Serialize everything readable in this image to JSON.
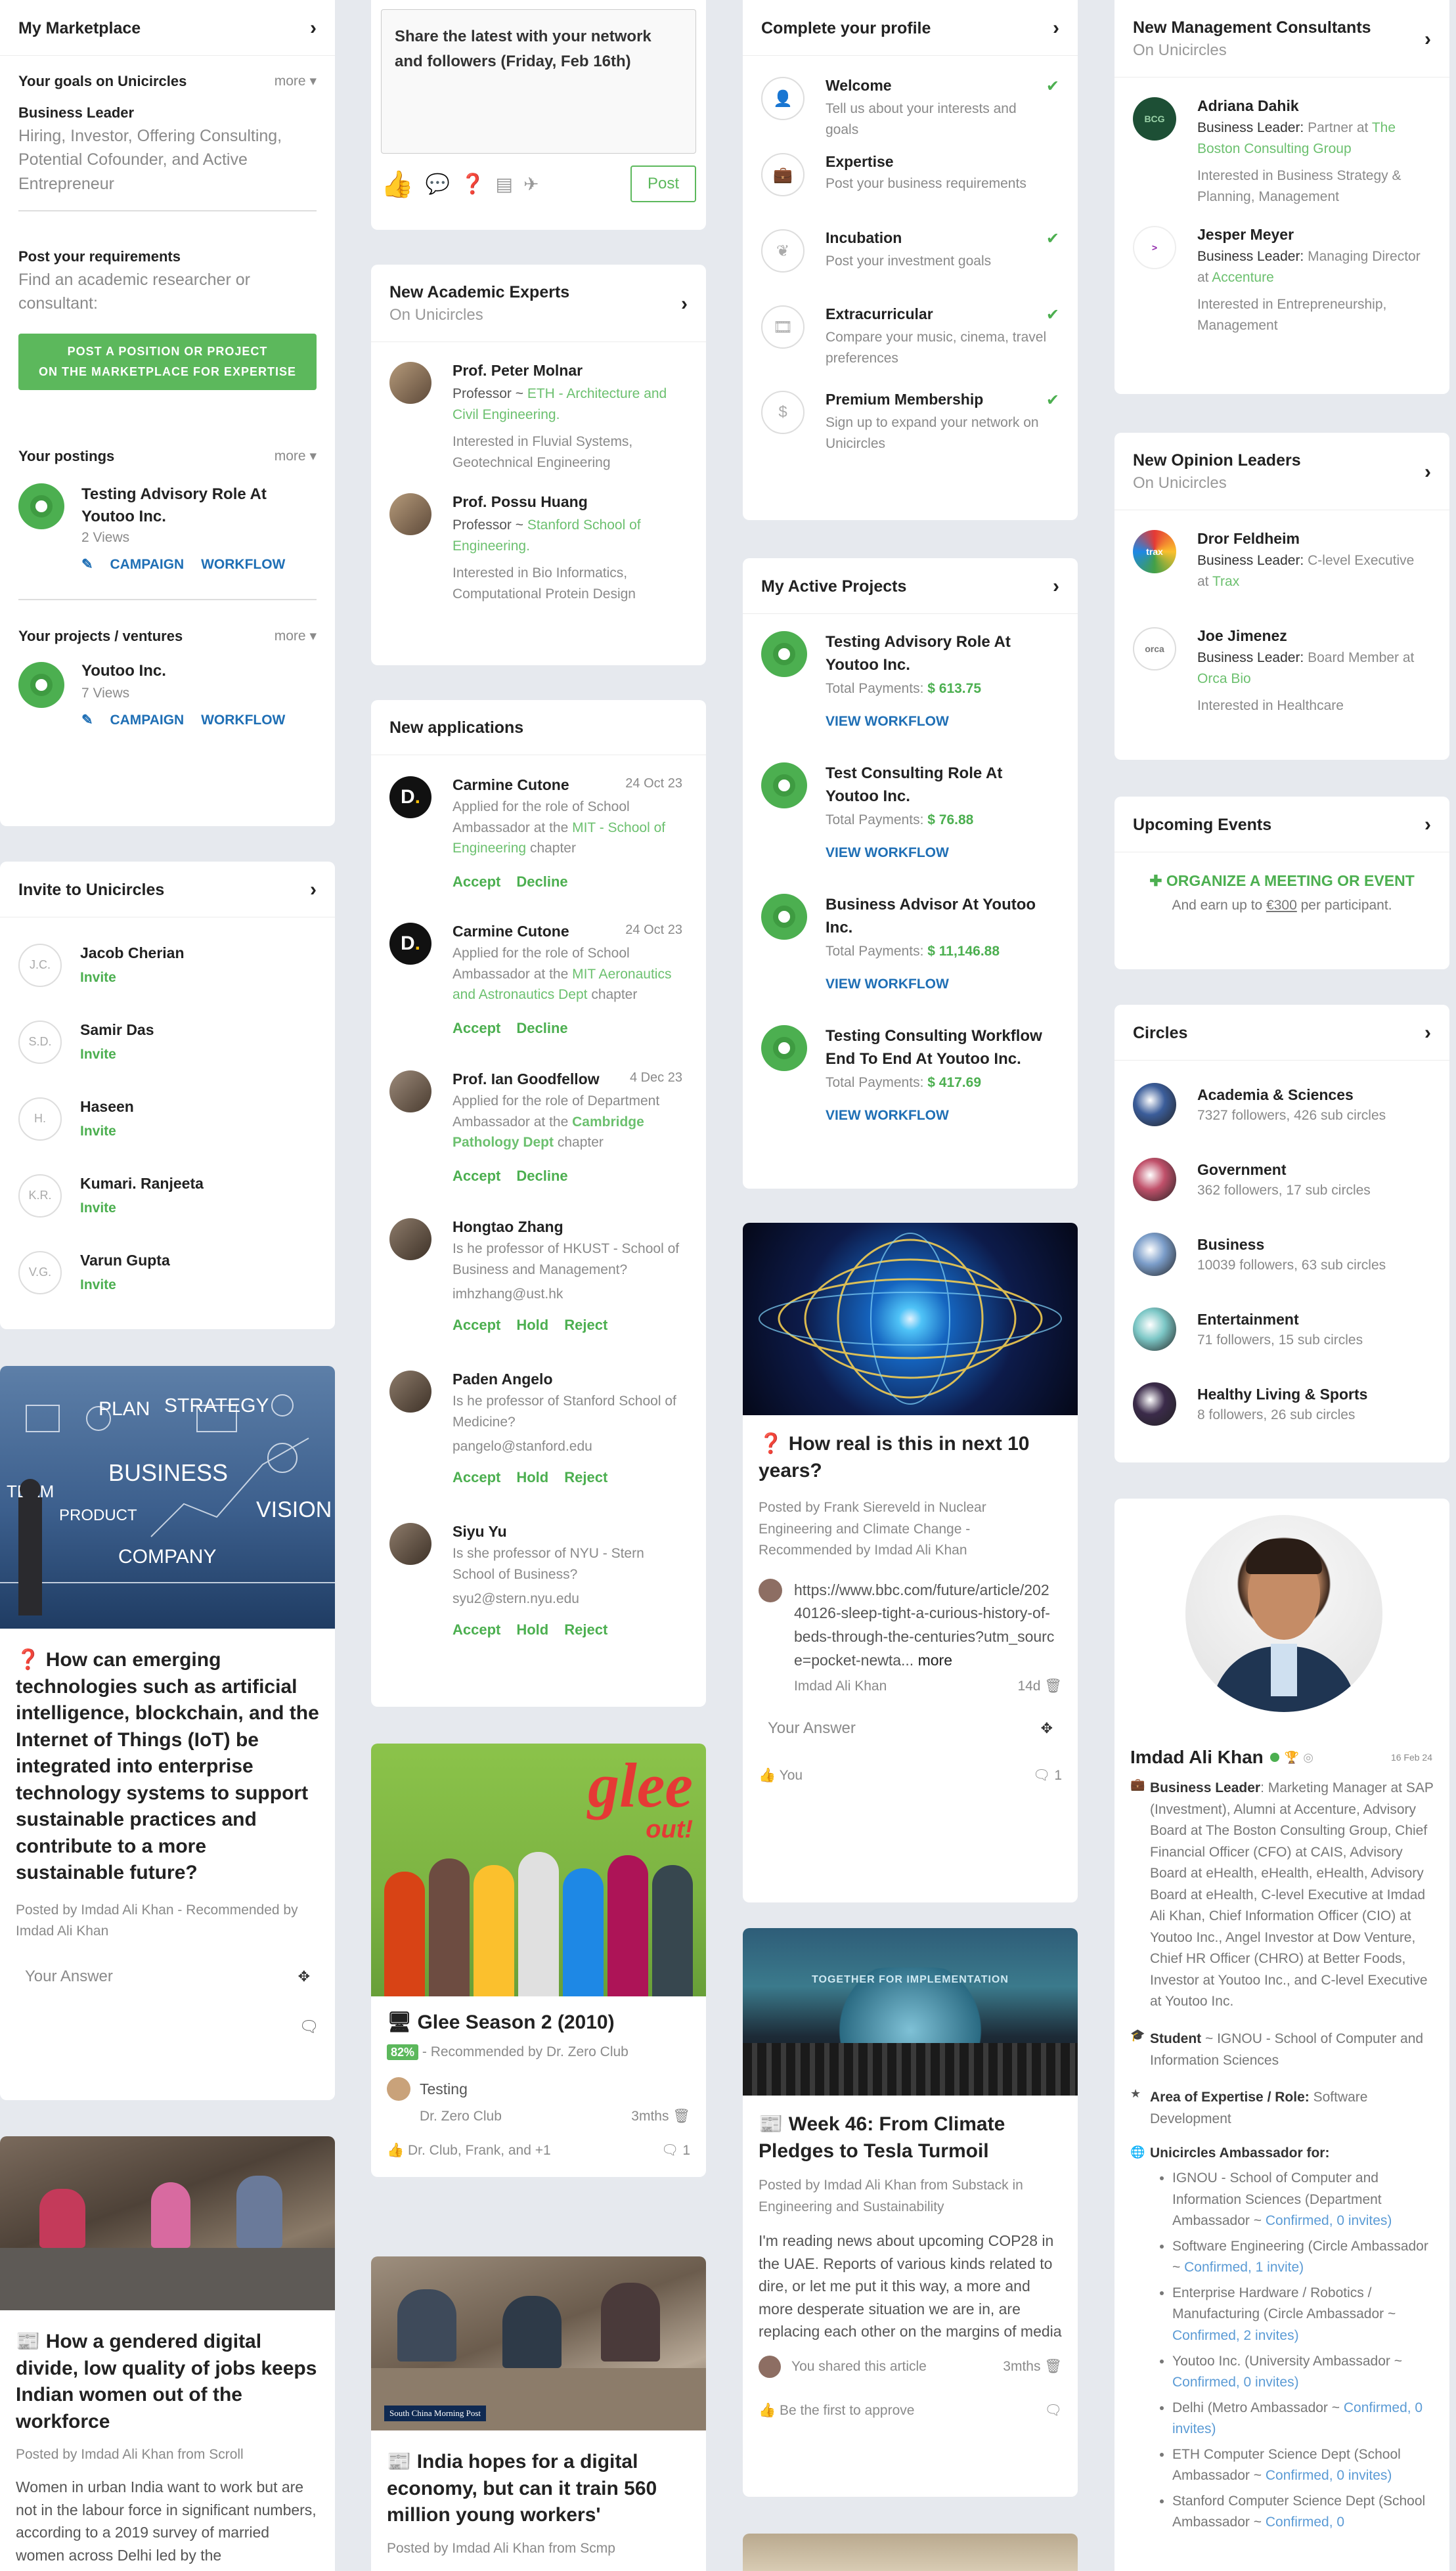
{
  "marketplace": {
    "title": "My Marketplace",
    "goals_heading": "Your goals on Unicircles",
    "more": "more",
    "goal_role": "Business Leader",
    "goal_desc": "Hiring, Investor, Offering Consulting, Potential Cofounder, and Active Entrepreneur",
    "req_heading": "Post your requirements",
    "req_desc": "Find an academic researcher or consultant:",
    "post_btn_line1": "POST A POSITION OR PROJECT",
    "post_btn_line2": "ON THE MARKETPLACE FOR EXPERTISE",
    "postings_heading": "Your postings",
    "posting_title": "Testing Advisory Role At Youtoo Inc.",
    "posting_views": "2 Views",
    "campaign": "CAMPAIGN",
    "workflow": "WORKFLOW",
    "projects_heading": "Your projects / ventures",
    "project_title": "Youtoo Inc.",
    "project_views": "7 Views"
  },
  "invite": {
    "title": "Invite to Unicircles",
    "action": "Invite",
    "people": [
      {
        "initials": "J.C.",
        "name": "Jacob Cherian"
      },
      {
        "initials": "S.D.",
        "name": "Samir Das"
      },
      {
        "initials": "H.",
        "name": "Haseen"
      },
      {
        "initials": "K.R.",
        "name": "Kumari. Ranjeeta"
      },
      {
        "initials": "V.G.",
        "name": "Varun Gupta"
      }
    ]
  },
  "q1": {
    "title": "How can emerging technologies such as artificial intelligence, blockchain, and the Internet of Things (IoT) be integrated into enterprise technology systems to support sustainable practices and contribute to a more sustainable future?",
    "posted_by": "Posted by",
    "author": "Imdad Ali Khan",
    "rec": "- Recommended by",
    "recby": "Imdad Ali Khan",
    "answer_ph": "Your Answer",
    "img_words": [
      "PLAN",
      "STRATEGY",
      "TEAM",
      "BUSINESS",
      "PRODUCT",
      "VISION",
      "COMPANY"
    ]
  },
  "article1": {
    "title": "How a gendered digital divide, low quality of jobs keeps Indian women out of the workforce",
    "posted_by": "Posted by",
    "author": "Imdad Ali Khan",
    "from": "from",
    "source": "Scroll",
    "body": "Women in urban India want to work but are not in the labour force in significant numbers, according to a 2019 survey of married women across Delhi led by the"
  },
  "share": {
    "placeholder": "Share the latest with your network and followers (Friday, Feb 16th)",
    "post": "Post"
  },
  "experts": {
    "title": "New Academic Experts",
    "sub": "On Unicircles",
    "items": [
      {
        "name": "Prof. Peter Molnar",
        "role": "Professor ~",
        "org": "ETH - Architecture and Civil Engineering.",
        "interest": "Interested in Fluvial Systems, Geotechnical Engineering"
      },
      {
        "name": "Prof. Possu Huang",
        "role": "Professor ~",
        "org": "Stanford School of Engineering.",
        "interest": "Interested in Bio Informatics, Computational Protein Design"
      }
    ]
  },
  "applications": {
    "title": "New applications",
    "accept": "Accept",
    "decline": "Decline",
    "hold": "Hold",
    "reject": "Reject",
    "items": [
      {
        "name": "Carmine Cutone",
        "date": "24 Oct 23",
        "pre": "Applied for the role of School Ambassador at the",
        "org": "MIT - School of Engineering",
        "post": "chapter"
      },
      {
        "name": "Carmine Cutone",
        "date": "24 Oct 23",
        "pre": "Applied for the role of School Ambassador at the",
        "org": "MIT Aeronautics and Astronautics Dept",
        "post": "chapter"
      },
      {
        "name": "Prof. Ian Goodfellow",
        "date": "4 Dec 23",
        "pre": "Applied for the role of Department Ambassador at the",
        "org": "Cambridge Pathology Dept",
        "post": "chapter"
      }
    ],
    "requests": [
      {
        "name": "Hongtao Zhang",
        "q": "Is he professor of HKUST - School of Business and Management?",
        "email": "imhzhang@ust.hk"
      },
      {
        "name": "Paden Angelo",
        "q": "Is he professor of Stanford School of Medicine?",
        "email": "pangelo@stanford.edu"
      },
      {
        "name": "Siyu Yu",
        "q": "Is she professor of NYU - Stern School of Business?",
        "email": "syu2@stern.nyu.edu"
      }
    ]
  },
  "glee": {
    "title": "Glee Season 2 (2010)",
    "badge": "82%",
    "rec": "- Recommended by",
    "recby": "Dr. Zero Club",
    "comment": "Testing",
    "comment_author": "Dr. Zero Club",
    "comment_time": "3mths",
    "likes": "Dr. Club, Frank, and +1",
    "count": "1",
    "logo_text": "glee",
    "logo_sub": "out!"
  },
  "article2": {
    "title": "India hopes for a digital economy, but can it train 560 million young workers'",
    "posted_by": "Posted by",
    "author": "Imdad Ali Khan",
    "from": "from",
    "source": "Scmp",
    "img_caption": "South China Morning Post"
  },
  "profile": {
    "title": "Complete your profile",
    "items": [
      {
        "icon": "user-icon",
        "title": "Welcome",
        "desc": "Tell us about your interests and goals",
        "done": true
      },
      {
        "icon": "briefcase-icon",
        "title": "Expertise",
        "desc": "Post your business requirements",
        "done": false
      },
      {
        "icon": "leaf-icon",
        "title": "Incubation",
        "desc": "Post your investment goals",
        "done": true
      },
      {
        "icon": "film-icon",
        "title": "Extracurricular",
        "desc": "Compare your music, cinema, travel preferences",
        "done": true
      },
      {
        "icon": "dollar-icon",
        "title": "Premium Membership",
        "desc": "Sign up to expand your network on Unicircles",
        "done": true
      }
    ]
  },
  "projects": {
    "title": "My Active Projects",
    "total_label": "Total Payments:",
    "view": "VIEW WORKFLOW",
    "items": [
      {
        "name": "Testing Advisory Role At Youtoo Inc.",
        "amount": "$ 613.75"
      },
      {
        "name": "Test Consulting Role At Youtoo Inc.",
        "amount": "$ 76.88"
      },
      {
        "name": "Business Advisor At Youtoo Inc.",
        "amount": "$ 11,146.88"
      },
      {
        "name": "Testing Consulting Workflow End To End At Youtoo Inc.",
        "amount": "$ 417.69"
      }
    ]
  },
  "q2": {
    "title": "How real is this in next 10 years?",
    "posted_by": "Posted by",
    "author": "Frank Siereveld",
    "in": "in",
    "topic1": "Nuclear Engineering",
    "and": "and",
    "topic2": "Climate Change",
    "rec": "- Recommended by",
    "recby": "Imdad Ali Khan",
    "link": "https://www.bbc.com/future/article/20240126-sleep-tight-a-curious-history-of-beds-through-the-centuries?utm_source=pocket-newta...",
    "more": "more",
    "link_author": "Imdad Ali Khan",
    "link_time": "14d",
    "answer_ph": "Your Answer",
    "you": "You",
    "count": "1"
  },
  "week46": {
    "title": "Week 46: From Climate Pledges to Tesla Turmoil",
    "posted_by": "Posted by",
    "author": "Imdad Ali Khan",
    "from": "from",
    "source": "Substack",
    "in": "in",
    "topic1": "Engineering",
    "and": "and",
    "topic2": "Sustainability",
    "body": "I'm reading news about upcoming COP28 in the UAE. Reports of various kinds related to dire, or let me put it this way, a more and more desperate situation we are in, are replacing each other on the margins of media outlet announcements...",
    "shared": "You shared this article",
    "time": "3mths",
    "approve": "Be the first to approve",
    "banner": "TOGETHER FOR IMPLEMENTATION"
  },
  "consultants": {
    "title": "New Management Consultants",
    "sub": "On Unicircles",
    "items": [
      {
        "name": "Adriana Dahik",
        "role": "Business Leader:",
        "pre": "Partner at",
        "org": "The Boston Consulting Group",
        "interest": "Interested in Business Strategy & Planning, Management",
        "logo": "BCG"
      },
      {
        "name": "Jesper Meyer",
        "role": "Business Leader:",
        "pre": "Managing Director at",
        "org": "Accenture",
        "interest": "Interested in Entrepreneurship, Management",
        "logo": ">"
      }
    ]
  },
  "opinion": {
    "title": "New Opinion Leaders",
    "sub": "On Unicircles",
    "items": [
      {
        "name": "Dror Feldheim",
        "role": "Business Leader:",
        "pre": "C-level Executive at",
        "org": "Trax",
        "interest": "",
        "logo": "trax"
      },
      {
        "name": "Joe Jimenez",
        "role": "Business Leader:",
        "pre": "Board Member at",
        "org": "Orca Bio",
        "interest": "Interested in Healthcare",
        "logo": "orca"
      }
    ]
  },
  "events": {
    "title": "Upcoming Events",
    "cta": "ORGANIZE A MEETING OR EVENT",
    "earn_pre": "And earn up to",
    "earn_amt": "€300",
    "earn_post": "per participant."
  },
  "circles": {
    "title": "Circles",
    "items": [
      {
        "name": "Academia & Sciences",
        "stats": "7327 followers, 426 sub circles",
        "color": "#3b5d9a"
      },
      {
        "name": "Government",
        "stats": "362 followers, 17 sub circles",
        "color": "#c0506a"
      },
      {
        "name": "Business",
        "stats": "10039 followers, 63 sub circles",
        "color": "#7b9dc9"
      },
      {
        "name": "Entertainment",
        "stats": "71 followers, 15 sub circles",
        "color": "#7cc7c6"
      },
      {
        "name": "Healthy Living & Sports",
        "stats": "8 followers, 26 sub circles",
        "color": "#3b2b4a"
      }
    ]
  },
  "user": {
    "name": "Imdad Ali Khan",
    "date": "16 Feb 24",
    "bl_label": "Business Leader",
    "bl_text": ": Marketing Manager at SAP (Investment), Alumni at Accenture, Advisory Board at The Boston Consulting Group, Chief Financial Officer (CFO) at CAIS, Advisory Board at eHealth, eHealth, eHealth, Advisory Board at eHealth, C-level Executive at Imdad Ali Khan, Chief Information Officer (CIO) at Youtoo Inc., Angel Investor at Dow Venture, Chief HR Officer (CHRO) at Better Foods, Investor at Youtoo Inc., and C-level Executive at Youtoo Inc.",
    "student_label": "Student",
    "student_text": "~ IGNOU - School of Computer and Information Sciences",
    "area_label": "Area of Expertise / Role:",
    "area_text": "Software Development",
    "amb_label": "Unicircles Ambassador for:",
    "amb": [
      {
        "text": "IGNOU - School of Computer and Information Sciences (Department Ambassador ~",
        "status": "Confirmed, 0 invites)"
      },
      {
        "text": "Software Engineering (Circle Ambassador ~",
        "status": "Confirmed, 1 invite)"
      },
      {
        "text": "Enterprise Hardware / Robotics / Manufacturing (Circle Ambassador ~",
        "status": "Confirmed, 2 invites)"
      },
      {
        "text": "Youtoo Inc. (University Ambassador ~",
        "status": "Confirmed, 0 invites)"
      },
      {
        "text": "Delhi (Metro Ambassador ~",
        "status": "Confirmed, 0 invites)"
      },
      {
        "text": "ETH Computer Science Dept (School Ambassador ~",
        "status": "Confirmed, 0 invites)"
      },
      {
        "text": "Stanford Computer Science Dept (School Ambassador ~",
        "status": "Confirmed, 0"
      }
    ]
  }
}
